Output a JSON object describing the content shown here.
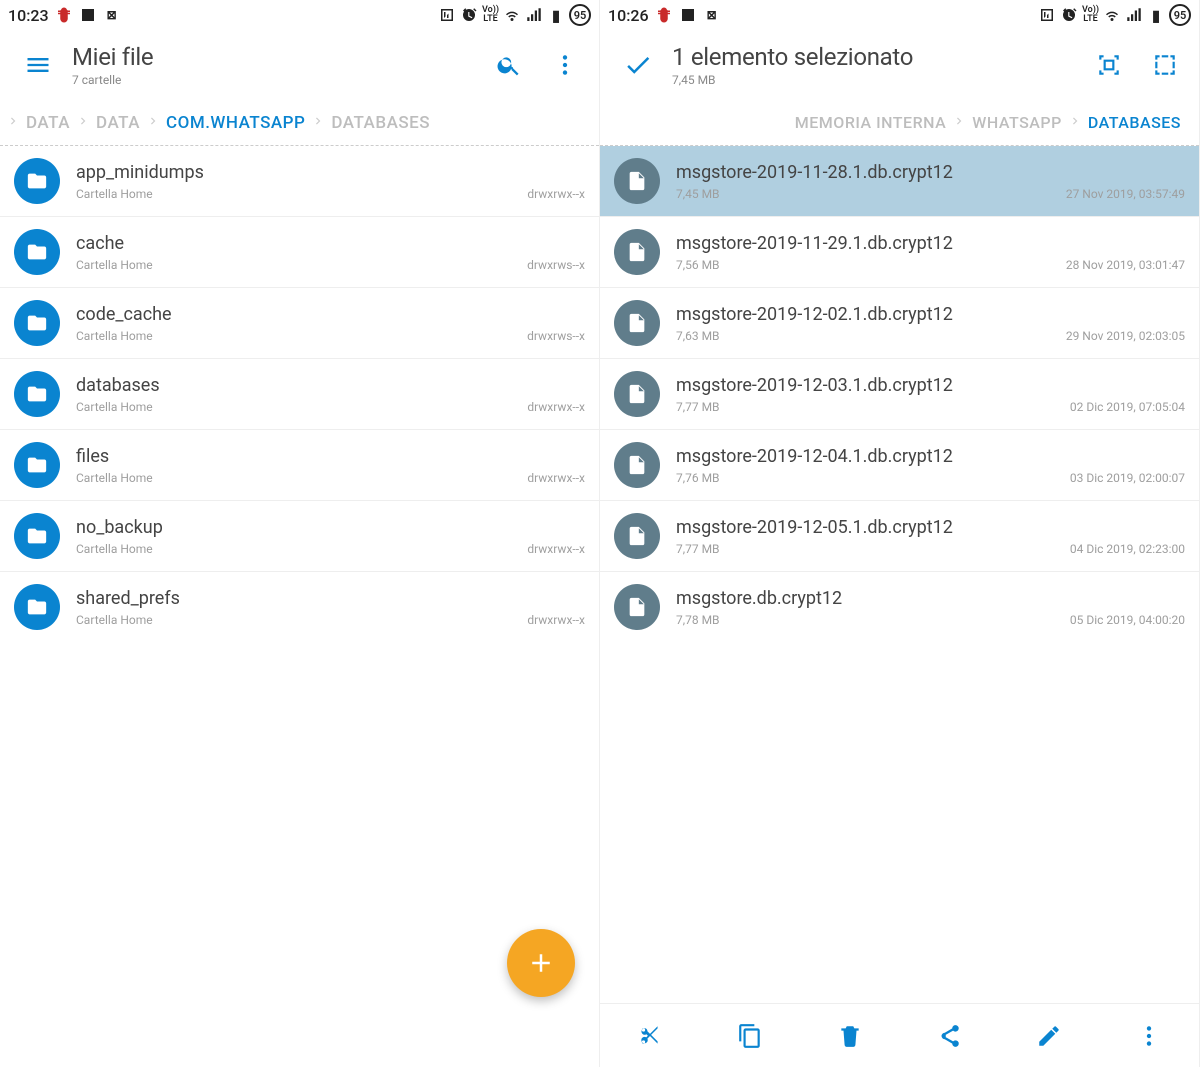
{
  "left": {
    "status": {
      "time": "10:23",
      "battery": "95"
    },
    "appbar": {
      "title": "Miei file",
      "subtitle": "7 cartelle"
    },
    "breadcrumb": [
      {
        "label": "DATA",
        "active": false
      },
      {
        "label": "DATA",
        "active": false
      },
      {
        "label": "COM.WHATSAPP",
        "active": true
      },
      {
        "label": "DATABASES",
        "active": false
      }
    ],
    "folders": [
      {
        "name": "app_minidumps",
        "sub": "Cartella Home",
        "perm": "drwxrwx--x"
      },
      {
        "name": "cache",
        "sub": "Cartella Home",
        "perm": "drwxrws--x"
      },
      {
        "name": "code_cache",
        "sub": "Cartella Home",
        "perm": "drwxrws--x"
      },
      {
        "name": "databases",
        "sub": "Cartella Home",
        "perm": "drwxrwx--x"
      },
      {
        "name": "files",
        "sub": "Cartella Home",
        "perm": "drwxrwx--x"
      },
      {
        "name": "no_backup",
        "sub": "Cartella Home",
        "perm": "drwxrwx--x"
      },
      {
        "name": "shared_prefs",
        "sub": "Cartella Home",
        "perm": "drwxrwx--x"
      }
    ]
  },
  "right": {
    "status": {
      "time": "10:26",
      "battery": "95"
    },
    "appbar": {
      "title": "1 elemento selezionato",
      "subtitle": "7,45 MB"
    },
    "breadcrumb": [
      {
        "label": "MEMORIA INTERNA",
        "active": false
      },
      {
        "label": "WHATSAPP",
        "active": false
      },
      {
        "label": "DATABASES",
        "active": true
      }
    ],
    "files": [
      {
        "name": "msgstore-2019-11-28.1.db.crypt12",
        "size": "7,45 MB",
        "date": "27 Nov 2019, 03:57:49",
        "selected": true
      },
      {
        "name": "msgstore-2019-11-29.1.db.crypt12",
        "size": "7,56 MB",
        "date": "28 Nov 2019, 03:01:47",
        "selected": false
      },
      {
        "name": "msgstore-2019-12-02.1.db.crypt12",
        "size": "7,63 MB",
        "date": "29 Nov 2019, 02:03:05",
        "selected": false
      },
      {
        "name": "msgstore-2019-12-03.1.db.crypt12",
        "size": "7,77 MB",
        "date": "02 Dic 2019, 07:05:04",
        "selected": false
      },
      {
        "name": "msgstore-2019-12-04.1.db.crypt12",
        "size": "7,76 MB",
        "date": "03 Dic 2019, 02:00:07",
        "selected": false
      },
      {
        "name": "msgstore-2019-12-05.1.db.crypt12",
        "size": "7,77 MB",
        "date": "04 Dic 2019, 02:23:00",
        "selected": false
      },
      {
        "name": "msgstore.db.crypt12",
        "size": "7,78 MB",
        "date": "05 Dic 2019, 04:00:20",
        "selected": false
      }
    ]
  }
}
